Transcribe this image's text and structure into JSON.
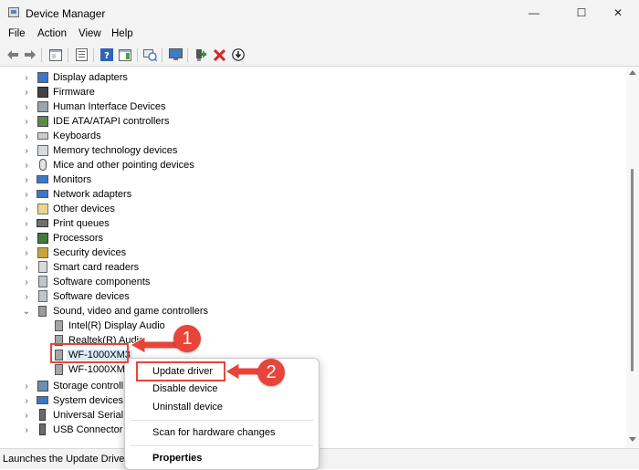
{
  "window": {
    "title": "Device Manager",
    "minimize": "—",
    "maximize": "☐",
    "close": "✕"
  },
  "menu": {
    "items": [
      "File",
      "Action",
      "View",
      "Help"
    ]
  },
  "toolbar": {
    "icons": [
      "back-arrow-icon",
      "forward-arrow-icon",
      "console-tree-icon",
      "properties-icon",
      "help-icon",
      "action-pane-icon",
      "scan-hardware-icon",
      "monitor-icon",
      "enable-device-icon",
      "uninstall-device-icon",
      "update-driver-icon"
    ]
  },
  "tree": {
    "categories": [
      {
        "label": "Display adapters",
        "icon": "display-adapter-icon",
        "expanded": false
      },
      {
        "label": "Firmware",
        "icon": "firmware-icon",
        "expanded": false
      },
      {
        "label": "Human Interface Devices",
        "icon": "hid-icon",
        "expanded": false
      },
      {
        "label": "IDE ATA/ATAPI controllers",
        "icon": "ide-controller-icon",
        "expanded": false
      },
      {
        "label": "Keyboards",
        "icon": "keyboard-icon",
        "expanded": false
      },
      {
        "label": "Memory technology devices",
        "icon": "memory-device-icon",
        "expanded": false
      },
      {
        "label": "Mice and other pointing devices",
        "icon": "mouse-icon",
        "expanded": false
      },
      {
        "label": "Monitors",
        "icon": "monitor-icon",
        "expanded": false
      },
      {
        "label": "Network adapters",
        "icon": "network-adapter-icon",
        "expanded": false
      },
      {
        "label": "Other devices",
        "icon": "other-devices-icon",
        "expanded": false
      },
      {
        "label": "Print queues",
        "icon": "printer-icon",
        "expanded": false
      },
      {
        "label": "Processors",
        "icon": "processor-icon",
        "expanded": false
      },
      {
        "label": "Security devices",
        "icon": "security-device-icon",
        "expanded": false
      },
      {
        "label": "Smart card readers",
        "icon": "smart-card-icon",
        "expanded": false
      },
      {
        "label": "Software components",
        "icon": "software-component-icon",
        "expanded": false
      },
      {
        "label": "Software devices",
        "icon": "software-device-icon",
        "expanded": false
      },
      {
        "label": "Sound, video and game controllers",
        "icon": "speaker-icon",
        "expanded": true
      }
    ],
    "sound_children": [
      "Intel(R) Display Audio",
      "Realtek(R) Audio",
      "WF-1000XM3",
      "WF-1000XM"
    ],
    "categories_after": [
      {
        "label": "Storage controll",
        "icon": "storage-controller-icon"
      },
      {
        "label": "System devices",
        "icon": "system-device-icon"
      },
      {
        "label": "Universal Serial I",
        "icon": "usb-icon"
      },
      {
        "label": "USB Connector",
        "icon": "usb-connector-icon"
      }
    ]
  },
  "context_menu": {
    "update_driver": "Update driver",
    "disable_device": "Disable device",
    "uninstall_device": "Uninstall device",
    "scan_hardware": "Scan for hardware changes",
    "properties": "Properties"
  },
  "callouts": {
    "step1": "1",
    "step2": "2",
    "color": "#e8443a"
  },
  "status": {
    "text": "Launches the Update Driver"
  }
}
